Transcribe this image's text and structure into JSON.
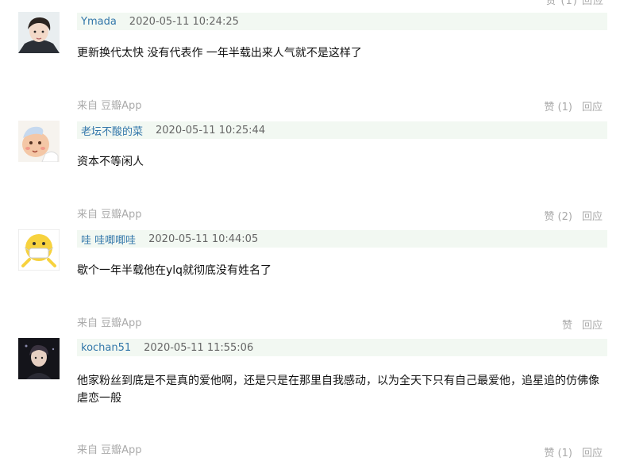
{
  "top_cut": "赞 (1) 回应",
  "comments": [
    {
      "author": "Ymada",
      "time": "2020-05-11 10:24:25",
      "text": "更新换代太快 没有代表作 一年半载出来人气就不是这样了",
      "source": "来自 豆瓣App",
      "like": "赞 (1)",
      "reply": "回应",
      "avatar_icon": "boy-portrait-avatar"
    },
    {
      "author": "老坛不酸的菜",
      "time": "2020-05-11 10:25:44",
      "text": "资本不等闲人",
      "source": "来自 豆瓣App",
      "like": "赞 (2)",
      "reply": "回应",
      "avatar_icon": "cartoon-baby-avatar"
    },
    {
      "author": "哇 哇唧唧哇",
      "time": "2020-05-11 10:44:05",
      "text": "歇个一年半载他在ylq就彻底没有姓名了",
      "source": "来自 豆瓣App",
      "like": "赞",
      "reply": "回应",
      "avatar_icon": "masked-emoji-avatar"
    },
    {
      "author": "kochan51",
      "time": "2020-05-11 11:55:06",
      "text": "他家粉丝到底是不是真的爱他啊，还是只是在那里自我感动，以为全天下只有自己最爱他，追星追的仿佛像虐恋一般",
      "source": "来自 豆瓣App",
      "like": "赞 (1)",
      "reply": "回应",
      "avatar_icon": "dark-portrait-avatar"
    }
  ]
}
